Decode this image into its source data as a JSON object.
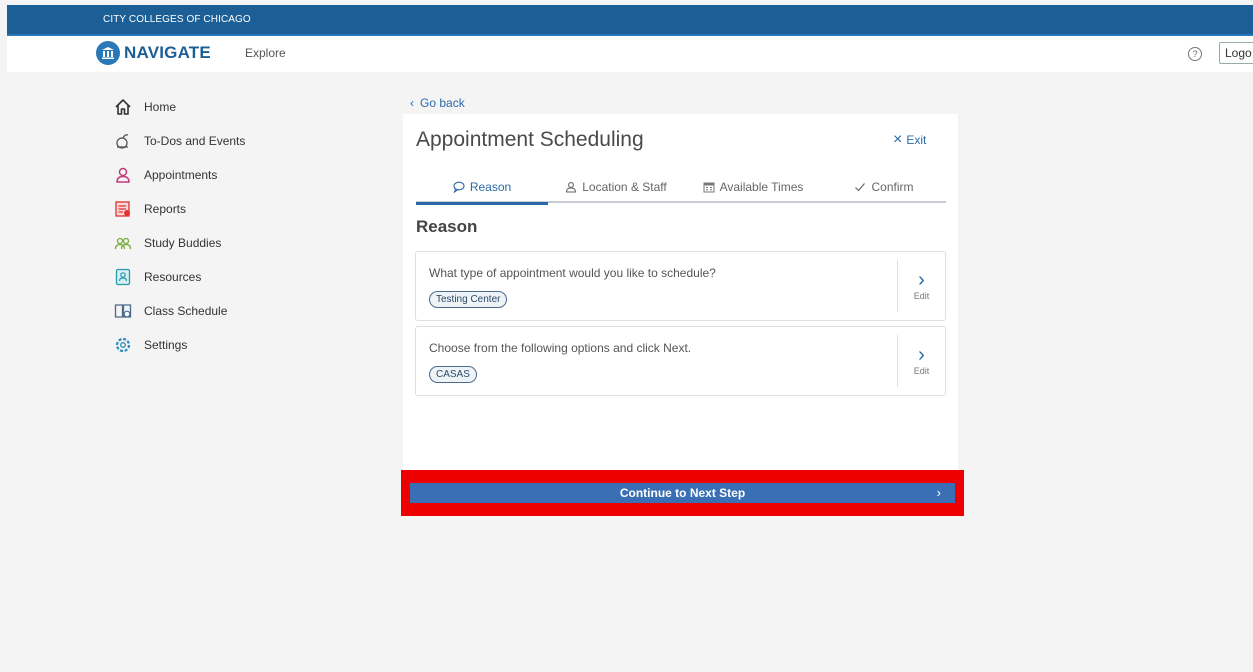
{
  "banner": {
    "text": "CITY COLLEGES OF CHICAGO"
  },
  "header": {
    "brand": "NAVIGATE",
    "explore": "Explore",
    "help_icon": "?",
    "logout": "Logo"
  },
  "sidebar": {
    "items": [
      {
        "label": "Home",
        "icon": "home-icon"
      },
      {
        "label": "To-Dos and Events",
        "icon": "todo-icon"
      },
      {
        "label": "Appointments",
        "icon": "person-icon"
      },
      {
        "label": "Reports",
        "icon": "reports-icon"
      },
      {
        "label": "Study Buddies",
        "icon": "study-buddies-icon"
      },
      {
        "label": "Resources",
        "icon": "resources-icon"
      },
      {
        "label": "Class Schedule",
        "icon": "class-schedule-icon"
      },
      {
        "label": "Settings",
        "icon": "gear-icon"
      }
    ]
  },
  "main": {
    "go_back": "Go back",
    "title": "Appointment Scheduling",
    "exit": "Exit",
    "tabs": [
      {
        "label": "Reason",
        "active": true
      },
      {
        "label": "Location & Staff",
        "active": false
      },
      {
        "label": "Available Times",
        "active": false
      },
      {
        "label": "Confirm",
        "active": false
      }
    ],
    "section_title": "Reason",
    "questions": [
      {
        "text": "What type of appointment would you like to schedule?",
        "answer": "Testing Center",
        "edit": "Edit"
      },
      {
        "text": "Choose from the following options and click Next.",
        "answer": "CASAS",
        "edit": "Edit"
      }
    ],
    "continue": "Continue to Next Step"
  },
  "colors": {
    "banner": "#1c5e96",
    "accent": "#2a6aa8",
    "continue_button": "#3a6fb5",
    "highlight": "#ee0000"
  }
}
